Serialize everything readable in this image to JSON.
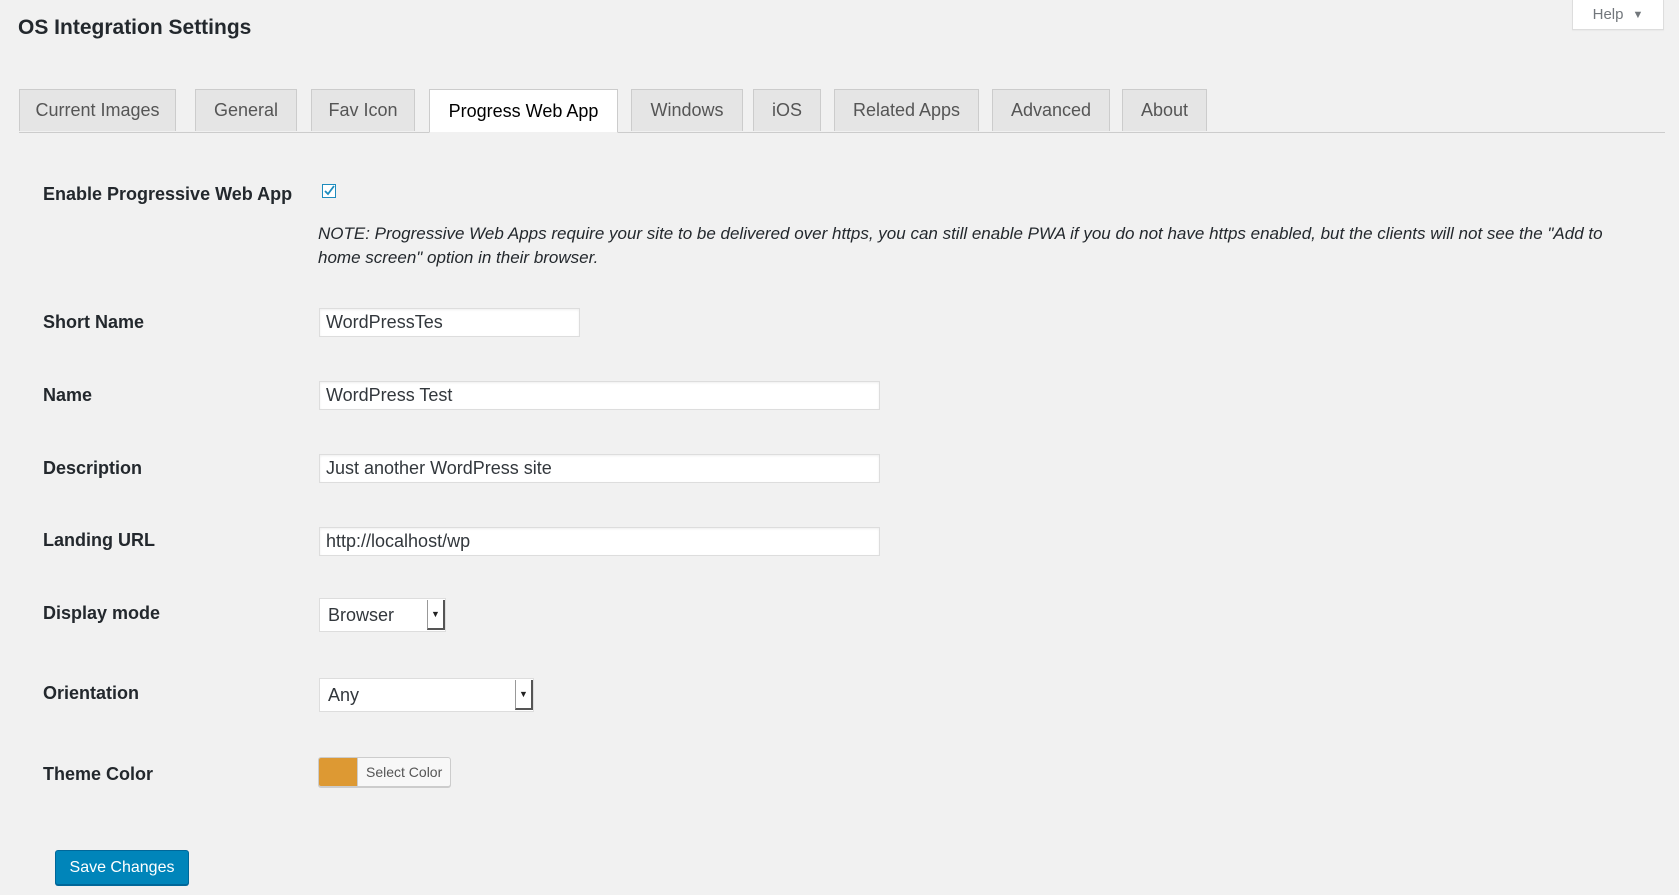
{
  "page": {
    "title": "OS Integration Settings",
    "help_label": "Help"
  },
  "tabs": [
    {
      "label": "Current Images"
    },
    {
      "label": "General"
    },
    {
      "label": "Fav Icon"
    },
    {
      "label": "Progress Web App",
      "active": true
    },
    {
      "label": "Windows"
    },
    {
      "label": "iOS"
    },
    {
      "label": "Related Apps"
    },
    {
      "label": "Advanced"
    },
    {
      "label": "About"
    }
  ],
  "form": {
    "enable_pwa": {
      "label": "Enable Progressive Web App",
      "checked": true,
      "note": "NOTE: Progressive Web Apps require your site to be delivered over https, you can still enable PWA if you do not have https enabled, but the clients will not see the \"Add to home screen\" option in their browser."
    },
    "short_name": {
      "label": "Short Name",
      "value": "WordPressTes"
    },
    "name": {
      "label": "Name",
      "value": "WordPress Test"
    },
    "description": {
      "label": "Description",
      "value": "Just another WordPress site"
    },
    "landing_url": {
      "label": "Landing URL",
      "value": "http://localhost/wp"
    },
    "display_mode": {
      "label": "Display mode",
      "value": "Browser"
    },
    "orientation": {
      "label": "Orientation",
      "value": "Any"
    },
    "theme_color": {
      "label": "Theme Color",
      "button_label": "Select Color",
      "color": "#dd9933"
    }
  },
  "save_label": "Save Changes",
  "colors": {
    "background": "#f1f1f1",
    "primary_button": "#0085ba",
    "checkbox_accent": "#1e8cbe"
  }
}
